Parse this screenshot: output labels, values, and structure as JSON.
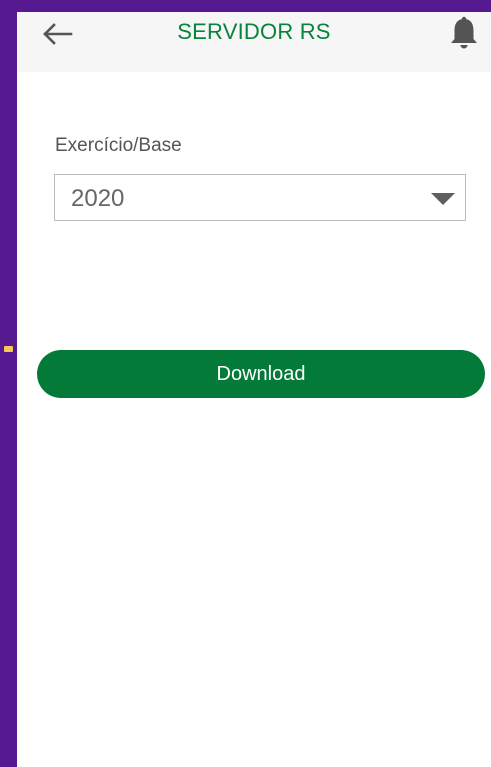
{
  "header": {
    "title": "SERVIDOR RS",
    "back_icon": "arrow-left-icon",
    "notification_icon": "bell-icon"
  },
  "form": {
    "field_label": "Exercício/Base",
    "selected_value": "2020",
    "dropdown_icon": "caret-down-icon"
  },
  "actions": {
    "download_label": "Download"
  },
  "colors": {
    "frame_purple": "#56198f",
    "title_green": "#07833c",
    "button_green": "#037a38",
    "marker_yellow": "#f2c75c"
  }
}
